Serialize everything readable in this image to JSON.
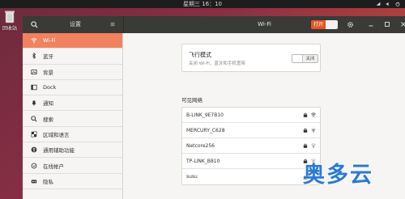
{
  "top_panel": {
    "clock": "星期三 16：10"
  },
  "desktop": {
    "trash_label": "回收站"
  },
  "header": {
    "sidebar_title": "设置",
    "pane_title": "Wi-Fi",
    "wifi_switch_label": "打开"
  },
  "sidebar": {
    "items": [
      {
        "label": "Wi-Fi",
        "icon": "wifi-icon",
        "active": true
      },
      {
        "label": "蓝牙",
        "icon": "bluetooth-icon"
      },
      {
        "label": "背景",
        "icon": "background-icon"
      },
      {
        "label": "Dock",
        "icon": "dock-icon"
      },
      {
        "label": "通知",
        "icon": "bell-icon"
      },
      {
        "label": "搜索",
        "icon": "search-icon"
      },
      {
        "label": "区域和语言",
        "icon": "region-icon"
      },
      {
        "label": "通用辅助功能",
        "icon": "accessibility-icon"
      },
      {
        "label": "在线帐户",
        "icon": "online-accounts-icon"
      },
      {
        "label": "隐私",
        "icon": "privacy-icon"
      }
    ]
  },
  "airplane": {
    "title": "飞行模式",
    "description": "关闭 Wi-Fi、蓝牙和手机宽带",
    "toggle_label": "关闭"
  },
  "networks": {
    "heading": "可见网络",
    "items": [
      {
        "name": "B-LINK_9E7B10",
        "secured": true
      },
      {
        "name": "MERCURY_C628",
        "secured": true
      },
      {
        "name": "Netcore256",
        "secured": true
      },
      {
        "name": "TP-LINK_B810",
        "secured": true
      },
      {
        "name": "susu",
        "secured": true
      }
    ]
  },
  "watermark": "奥多云",
  "colors": {
    "accent": "#e95420",
    "sidebar_active": "#f0825f",
    "header": "#3a3a37",
    "watermark": "#2b79d6"
  }
}
